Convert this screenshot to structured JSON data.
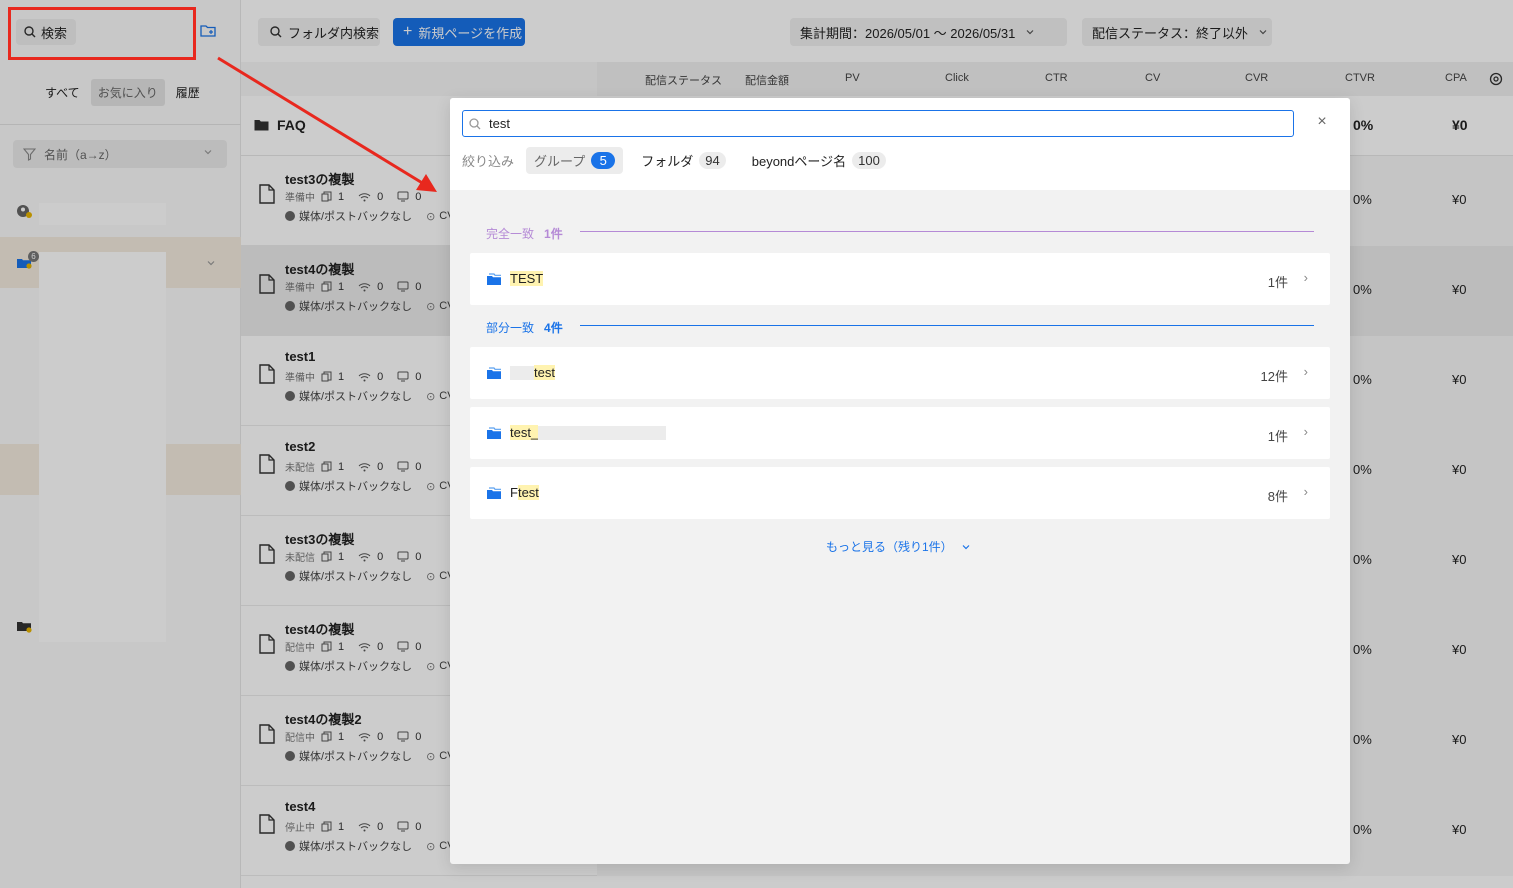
{
  "sidebar": {
    "search_label": "検索",
    "tabs": [
      {
        "label": "すべて",
        "active": false
      },
      {
        "label": "お気に入り",
        "active": true
      },
      {
        "label": "履歴",
        "active": false
      }
    ],
    "sort_label": "名前（a→z）",
    "folder_badge": "6"
  },
  "toolbar": {
    "folder_search_label": "フォルダ内検索",
    "new_page_label": "新規ページを作成",
    "period_label": "集計期間：2026/05/01 〜 2026/05/31",
    "status_filter_label": "配信ステータス：終了以外"
  },
  "table": {
    "columns": [
      "配信ステータス",
      "配信金額",
      "PV",
      "Click",
      "CTR",
      "CV",
      "CVR",
      "CTVR",
      "CPA"
    ],
    "faq": {
      "label": "FAQ",
      "ctr": "0%",
      "cpa": "¥0"
    },
    "rows": [
      {
        "name": "test3の複製",
        "status": "準備中",
        "pages": "1",
        "signal": "0",
        "cv": "0",
        "media": "媒体/ポストバックなし",
        "cv_label": "CV",
        "ctr": "0%",
        "cpa": "¥0"
      },
      {
        "name": "test4の複製",
        "status": "準備中",
        "pages": "1",
        "signal": "0",
        "cv": "0",
        "media": "媒体/ポストバックなし",
        "cv_label": "CV",
        "ctr": "0%",
        "cpa": "¥0"
      },
      {
        "name": "test1",
        "status": "準備中",
        "pages": "1",
        "signal": "0",
        "cv": "0",
        "media": "媒体/ポストバックなし",
        "cv_label": "CV",
        "ctr": "0%",
        "cpa": "¥0"
      },
      {
        "name": "test2",
        "status": "未配信",
        "pages": "1",
        "signal": "0",
        "cv": "0",
        "media": "媒体/ポストバックなし",
        "cv_label": "CV",
        "ctr": "0%",
        "cpa": "¥0"
      },
      {
        "name": "test3の複製",
        "status": "未配信",
        "pages": "1",
        "signal": "0",
        "cv": "0",
        "media": "媒体/ポストバックなし",
        "cv_label": "CV",
        "ctr": "0%",
        "cpa": "¥0"
      },
      {
        "name": "test4の複製",
        "status": "配信中",
        "pages": "1",
        "signal": "0",
        "cv": "0",
        "media": "媒体/ポストバックなし",
        "cv_label": "CV",
        "ctr": "0%",
        "cpa": "¥0"
      },
      {
        "name": "test4の複製2",
        "status": "配信中",
        "pages": "1",
        "signal": "0",
        "cv": "0",
        "media": "媒体/ポストバックなし",
        "cv_label": "CV",
        "ctr": "0%",
        "cpa": "¥0"
      },
      {
        "name": "test4",
        "status": "停止中",
        "pages": "1",
        "signal": "0",
        "cv": "0",
        "media": "媒体/ポストバックなし",
        "cv_label": "CV",
        "ctr": "0%",
        "cpa": "¥0"
      }
    ]
  },
  "modal": {
    "search_value": "test",
    "filter_label": "絞り込み",
    "filters": [
      {
        "label": "グループ",
        "count": "5",
        "active": true
      },
      {
        "label": "フォルダ",
        "count": "94",
        "active": false
      },
      {
        "label": "beyondページ名",
        "count": "100",
        "active": false
      }
    ],
    "exact": {
      "title": "完全一致",
      "count": "1件",
      "color": "#b58ad6"
    },
    "partial": {
      "title": "部分一致",
      "count": "4件",
      "color": "#1a73e8"
    },
    "results_exact": [
      {
        "prefix": "",
        "match": "TEST",
        "suffix": "",
        "count": "1件"
      }
    ],
    "results_partial": [
      {
        "prefix": "",
        "match": "test",
        "suffix": "",
        "count": "12件"
      },
      {
        "prefix": "",
        "match": "test_",
        "suffix": "",
        "count": "1件"
      },
      {
        "prefix": "F",
        "match": "test",
        "suffix": "",
        "count": "8件"
      }
    ],
    "more_label": "もっと見る（残り1件）"
  },
  "colors": {
    "accent": "#1a73e8",
    "annotation": "#e8281e",
    "highlight": "#fff3b0"
  }
}
